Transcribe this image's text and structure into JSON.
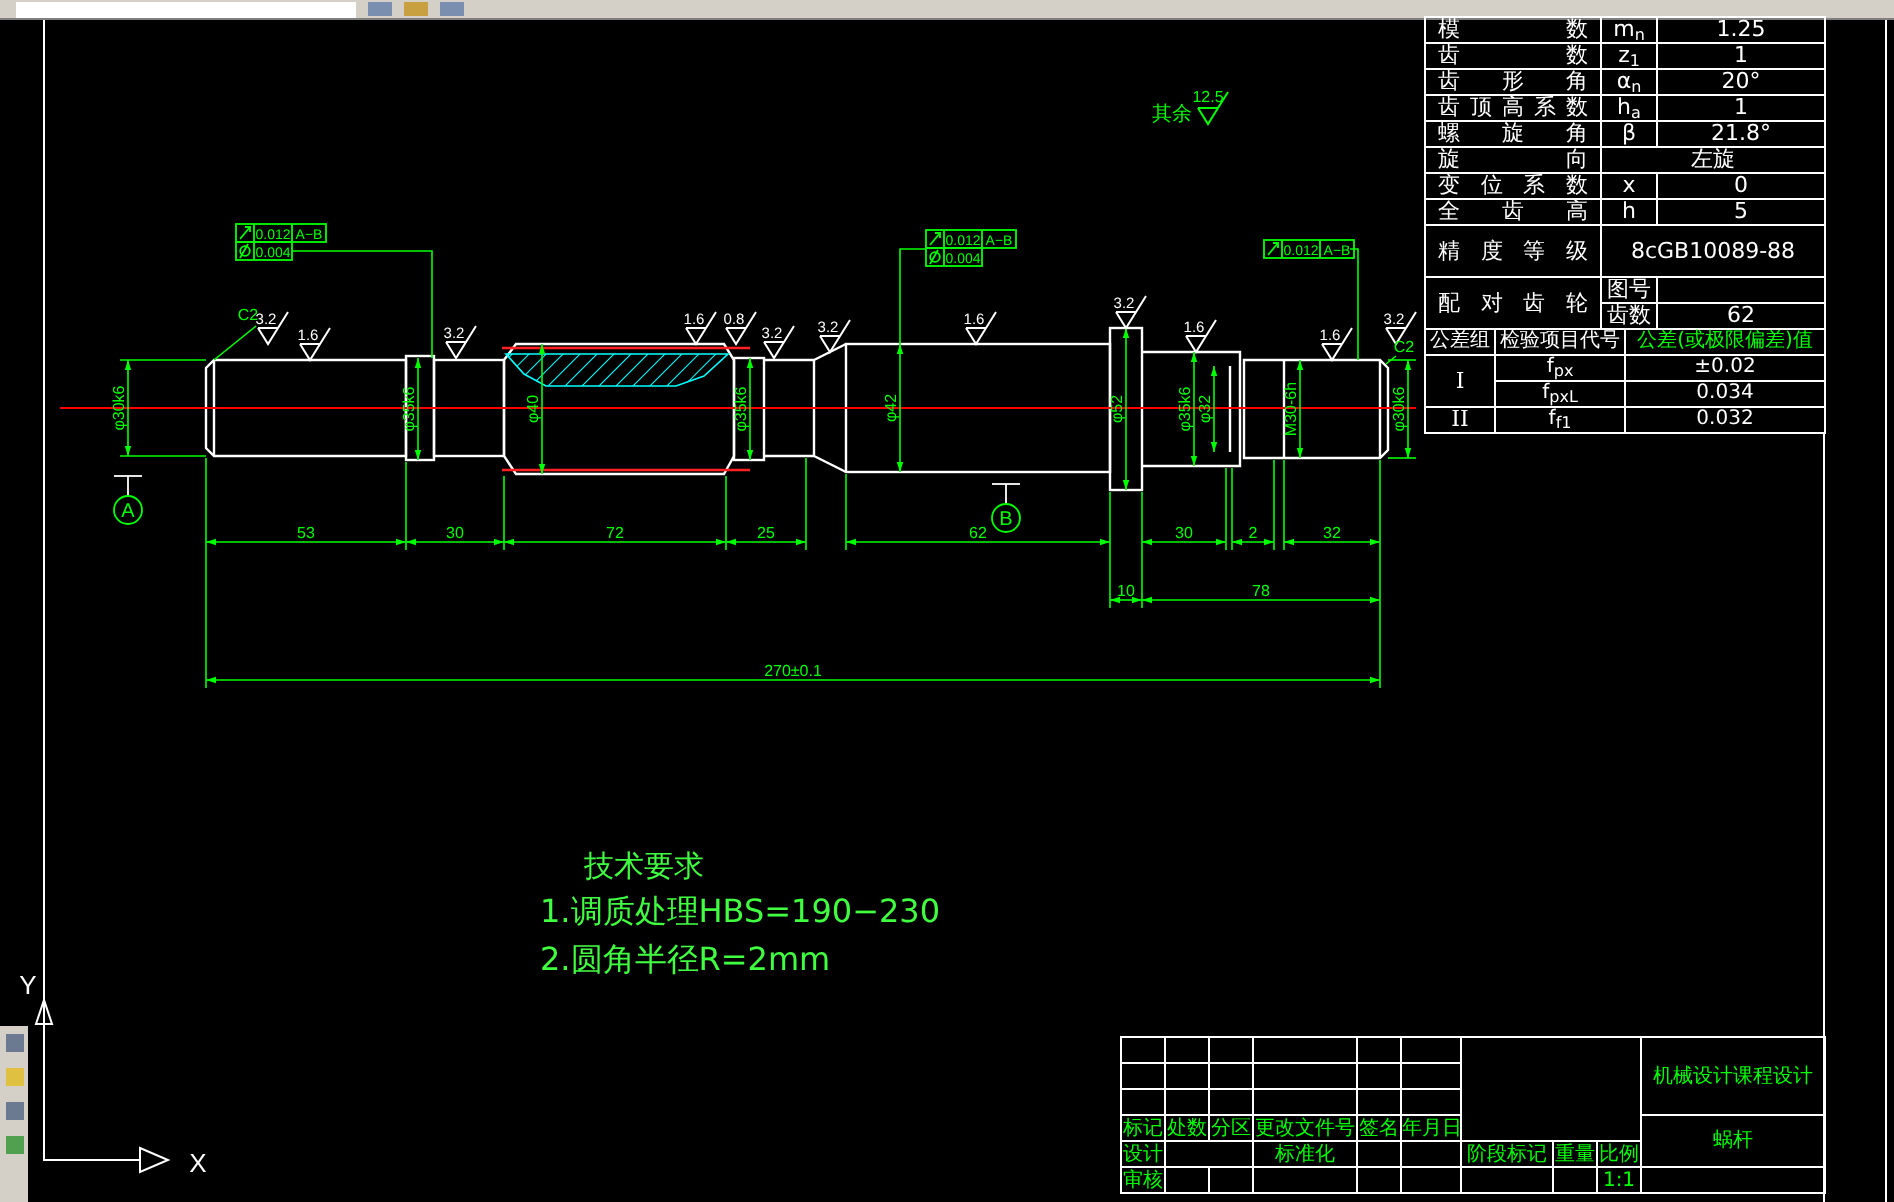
{
  "parameter_table": {
    "rows": [
      {
        "kind": "param",
        "label": "模数",
        "symbol": "m$_{n}$",
        "value": "1.25"
      },
      {
        "kind": "param",
        "label": "齿数",
        "symbol": "z$_{1}$",
        "value": "1"
      },
      {
        "kind": "param",
        "label": "齿形角",
        "symbol": "α$_{n}$",
        "value": "20°"
      },
      {
        "kind": "param",
        "label": "齿顶高系数",
        "symbol": "h$_{a}$",
        "value": "1"
      },
      {
        "kind": "param",
        "label": "螺旋角",
        "symbol": "β",
        "value": "21.8°"
      },
      {
        "kind": "param",
        "label": "旋向",
        "value": "左旋"
      },
      {
        "kind": "param",
        "label": "变位系数",
        "symbol": "x",
        "value": "0"
      },
      {
        "kind": "param",
        "label": "全齿高",
        "symbol": "h",
        "value": "5"
      },
      {
        "kind": "grade",
        "label": "精度等级",
        "value": "8cGB10089-88"
      },
      {
        "kind": "mating",
        "label": "配对齿轮",
        "parts": [
          {
            "label": "图号"
          },
          {
            "label": "齿数",
            "value": "62"
          }
        ]
      }
    ]
  },
  "tolerance_table": {
    "headers": [
      "公差组",
      "检验项目代号",
      "公差(或极限偏差)值"
    ],
    "groups": [
      {
        "group": "I",
        "items": [
          {
            "code": "f$_{px}$",
            "value": "±0.02"
          },
          {
            "code": "f$_{pxL}$",
            "value": "0.034"
          }
        ]
      },
      {
        "group": "II",
        "items": [
          {
            "code": "f$_{f1}$",
            "value": "0.032"
          }
        ]
      }
    ]
  },
  "drawing": {
    "general_roughness": {
      "label": "其余",
      "value": "12.5"
    },
    "tolerance_frames": [
      {
        "rows": [
          {
            "kind": "runout",
            "tolerance": "0.012",
            "datum": "A−B"
          },
          {
            "kind": "cylindricity",
            "tolerance": "0.004"
          }
        ]
      },
      {
        "rows": [
          {
            "kind": "runout",
            "tolerance": "0.012",
            "datum": "A−B"
          },
          {
            "kind": "cylindricity",
            "tolerance": "0.004"
          }
        ]
      },
      {
        "rows": [
          {
            "kind": "runout",
            "tolerance": "0.012",
            "datum": "A−B"
          }
        ]
      }
    ],
    "roughness": [
      "3.2",
      "1.6",
      "3.2",
      "1.6",
      "0.8",
      "3.2",
      "3.2",
      "1.6",
      "3.2",
      "1.6",
      "1.6",
      "3.2"
    ],
    "chamfers": [
      "C2",
      "C2"
    ],
    "diameters": [
      "φ30k6",
      "φ35k6",
      "φ40",
      "φ35k6",
      "φ42",
      "φ52",
      "φ35k6",
      "φ32",
      "M30-6h",
      "φ30k6"
    ],
    "lengths": [
      "53",
      "30",
      "72",
      "25",
      "62",
      "30",
      "2",
      "32",
      "10",
      "78",
      "270±0.1"
    ],
    "datums": [
      "A",
      "B"
    ]
  },
  "technical_requirements": {
    "title": "技术要求",
    "items": [
      "1.调质处理HBS=190−230",
      "2.圆角半径R=2mm"
    ]
  },
  "title_block": {
    "school": "机械设计课程设计",
    "part_name": "蜗杆",
    "revision_headers": [
      "标记",
      "处数",
      "分区",
      "更改文件号",
      "签名",
      "年月日"
    ],
    "design_label": "设计",
    "standardization_label": "标准化",
    "review_label": "审核",
    "info_headers": [
      "阶段标记",
      "重量",
      "比例"
    ],
    "scale": "1:1"
  },
  "axes": {
    "x": "X",
    "y": "Y"
  }
}
